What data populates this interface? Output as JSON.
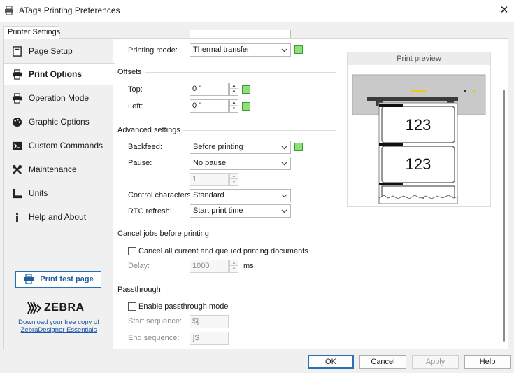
{
  "window": {
    "title": "ATags Printing Preferences"
  },
  "tabs": [
    {
      "label": "Printer Settings"
    }
  ],
  "sidebar": {
    "items": [
      {
        "label": "Page Setup",
        "icon": "page-setup-icon"
      },
      {
        "label": "Print Options",
        "icon": "printer-icon",
        "active": true
      },
      {
        "label": "Operation Mode",
        "icon": "printer-icon"
      },
      {
        "label": "Graphic Options",
        "icon": "palette-icon"
      },
      {
        "label": "Custom Commands",
        "icon": "terminal-icon"
      },
      {
        "label": "Maintenance",
        "icon": "tools-icon"
      },
      {
        "label": "Units",
        "icon": "ruler-icon"
      },
      {
        "label": "Help and About",
        "icon": "info-icon"
      }
    ],
    "print_test_label": "Print test page",
    "logo_text": "ZEBRA",
    "download_link": "Download your free copy of ZebraDesigner Essentials"
  },
  "printing": {
    "mode_label": "Printing mode:",
    "mode_value": "Thermal transfer"
  },
  "offsets": {
    "title": "Offsets",
    "top_label": "Top:",
    "top_value": "0 \"",
    "left_label": "Left:",
    "left_value": "0 \""
  },
  "advanced": {
    "title": "Advanced settings",
    "backfeed_label": "Backfeed:",
    "backfeed_value": "Before printing",
    "pause_label": "Pause:",
    "pause_value": "No pause",
    "pause_count": "1",
    "control_label": "Control characters:",
    "control_value": "Standard",
    "rtc_label": "RTC refresh:",
    "rtc_value": "Start print time"
  },
  "cancel": {
    "title": "Cancel jobs before printing",
    "checkbox_label": "Cancel all current and queued printing documents",
    "delay_label": "Delay:",
    "delay_value": "1000",
    "delay_unit": "ms"
  },
  "passthrough": {
    "title": "Passthrough",
    "checkbox_label": "Enable passthrough mode",
    "start_label": "Start sequence:",
    "start_value": "${",
    "end_label": "End sequence:",
    "end_value": "}$"
  },
  "preview": {
    "title": "Print preview",
    "label1": "123",
    "label2": "123"
  },
  "buttons": {
    "ok": "OK",
    "cancel": "Cancel",
    "apply": "Apply",
    "help": "Help"
  },
  "colors": {
    "accent": "#2a6fb0",
    "green_indicator": "#8fe07a",
    "link": "#1a55a8"
  }
}
